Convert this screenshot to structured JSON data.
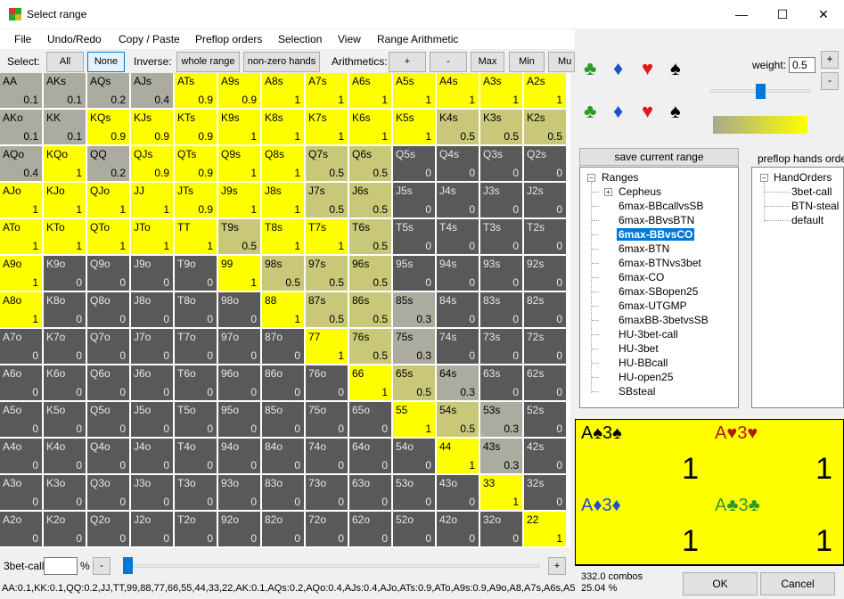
{
  "window": {
    "title": "Select range",
    "minimize": "—",
    "maximize": "☐",
    "close": "✕"
  },
  "menu": [
    "File",
    "Undo/Redo",
    "Copy / Paste",
    "Preflop orders",
    "Selection",
    "View",
    "Range Arithmetic"
  ],
  "toolbar": {
    "select_label": "Select:",
    "all": "All",
    "none": "None",
    "inverse_label": "Inverse:",
    "whole_range": "whole range",
    "nonzero": "non-zero hands",
    "arith_label": "Arithmetics:",
    "plus": "+",
    "minus": "-",
    "max": "Max",
    "min": "Min",
    "mu": "Mu"
  },
  "grid": [
    [
      "AA|0.1",
      "AKs|0.1",
      "AQs|0.2",
      "AJs|0.4",
      "ATs|0.9",
      "A9s|0.9",
      "A8s|1",
      "A7s|1",
      "A6s|1",
      "A5s|1",
      "A4s|1",
      "A3s|1",
      "A2s|1"
    ],
    [
      "AKo|0.1",
      "KK|0.1",
      "KQs|0.9",
      "KJs|0.9",
      "KTs|0.9",
      "K9s|1",
      "K8s|1",
      "K7s|1",
      "K6s|1",
      "K5s|1",
      "K4s|0.5",
      "K3s|0.5",
      "K2s|0.5"
    ],
    [
      "AQo|0.4",
      "KQo|1",
      "QQ|0.2",
      "QJs|0.9",
      "QTs|0.9",
      "Q9s|1",
      "Q8s|1",
      "Q7s|0.5",
      "Q6s|0.5",
      "Q5s|0",
      "Q4s|0",
      "Q3s|0",
      "Q2s|0"
    ],
    [
      "AJo|1",
      "KJo|1",
      "QJo|1",
      "JJ|1",
      "JTs|0.9",
      "J9s|1",
      "J8s|1",
      "J7s|0.5",
      "J6s|0.5",
      "J5s|0",
      "J4s|0",
      "J3s|0",
      "J2s|0"
    ],
    [
      "ATo|1",
      "KTo|1",
      "QTo|1",
      "JTo|1",
      "TT|1",
      "T9s|0.5",
      "T8s|1",
      "T7s|1",
      "T6s|0.5",
      "T5s|0",
      "T4s|0",
      "T3s|0",
      "T2s|0"
    ],
    [
      "A9o|1",
      "K9o|0",
      "Q9o|0",
      "J9o|0",
      "T9o|0",
      "99|1",
      "98s|0.5",
      "97s|0.5",
      "96s|0.5",
      "95s|0",
      "94s|0",
      "93s|0",
      "92s|0"
    ],
    [
      "A8o|1",
      "K8o|0",
      "Q8o|0",
      "J8o|0",
      "T8o|0",
      "98o|0",
      "88|1",
      "87s|0.5",
      "86s|0.5",
      "85s|0.3",
      "84s|0",
      "83s|0",
      "82s|0"
    ],
    [
      "A7o|0",
      "K7o|0",
      "Q7o|0",
      "J7o|0",
      "T7o|0",
      "97o|0",
      "87o|0",
      "77|1",
      "76s|0.5",
      "75s|0.3",
      "74s|0",
      "73s|0",
      "72s|0"
    ],
    [
      "A6o|0",
      "K6o|0",
      "Q6o|0",
      "J6o|0",
      "T6o|0",
      "96o|0",
      "86o|0",
      "76o|0",
      "66|1",
      "65s|0.5",
      "64s|0.3",
      "63s|0",
      "62s|0"
    ],
    [
      "A5o|0",
      "K5o|0",
      "Q5o|0",
      "J5o|0",
      "T5o|0",
      "95o|0",
      "85o|0",
      "75o|0",
      "65o|0",
      "55|1",
      "54s|0.5",
      "53s|0.3",
      "52s|0"
    ],
    [
      "A4o|0",
      "K4o|0",
      "Q4o|0",
      "J4o|0",
      "T4o|0",
      "94o|0",
      "84o|0",
      "74o|0",
      "64o|0",
      "54o|0",
      "44|1",
      "43s|0.3",
      "42s|0"
    ],
    [
      "A3o|0",
      "K3o|0",
      "Q3o|0",
      "J3o|0",
      "T3o|0",
      "93o|0",
      "83o|0",
      "73o|0",
      "63o|0",
      "53o|0",
      "43o|0",
      "33|1",
      "32s|0"
    ],
    [
      "A2o|0",
      "K2o|0",
      "Q2o|0",
      "J2o|0",
      "T2o|0",
      "92o|0",
      "82o|0",
      "72o|0",
      "62o|0",
      "52o|0",
      "42o|0",
      "32o|0",
      "22|1"
    ]
  ],
  "colors": {
    "full": "#ffff00",
    "half": "#c8c878",
    "low": "#ababa0",
    "zero": "#595959"
  },
  "bottom": {
    "label": "3bet-call",
    "pct": "%",
    "minus": "-",
    "plus": "+",
    "slider_value": 0
  },
  "status": "AA:0.1,KK:0.1,QQ:0.2,JJ,TT,99,88,77,66,55,44,33,22,AK:0.1,AQs:0.2,AQo:0.4,AJs:0.4,AJo,ATs:0.9,ATo,A9s:0.9,A9o,A8,A7s,A6s,A5s",
  "side": {
    "suits_row1": [
      "♣",
      "♦",
      "♥",
      "♠"
    ],
    "suits_row2": [
      "♣",
      "♦",
      "♥",
      "♠"
    ],
    "weight_label": "weight:",
    "weight_value": "0.5",
    "weight_plus": "+",
    "weight_minus": "-",
    "weight_slider": 0.5,
    "save_button": "save current range",
    "tree_root": "Ranges",
    "tree_items": [
      "Cepheus",
      "6max-BBcallvsSB",
      "6max-BBvsBTN",
      "6max-BBvsCO",
      "6max-BTN",
      "6max-BTNvs3bet",
      "6max-CO",
      "6max-SBopen25",
      "6max-UTGMP",
      "6maxBB-3betvsSB",
      "HU-3bet-call",
      "HU-3bet",
      "HU-BBcall",
      "HU-open25",
      "SBsteal"
    ],
    "tree_selected": 3,
    "orders_title": "preflop hands orders",
    "orders_root": "HandOrders",
    "orders_items": [
      "3bet-call",
      "BTN-steal",
      "default"
    ],
    "combos": [
      {
        "hand": "A♠3♠",
        "value": "1",
        "color": "#000000"
      },
      {
        "hand": "A♥3♥",
        "value": "1",
        "color": "#b01818"
      },
      {
        "hand": "A♦3♦",
        "value": "1",
        "color": "#2050c8"
      },
      {
        "hand": "A♣3♣",
        "value": "1",
        "color": "#2a9a2a"
      }
    ],
    "combo_count": "332.0 combos",
    "combo_pct": "25.04 %",
    "ok": "OK",
    "cancel": "Cancel"
  }
}
